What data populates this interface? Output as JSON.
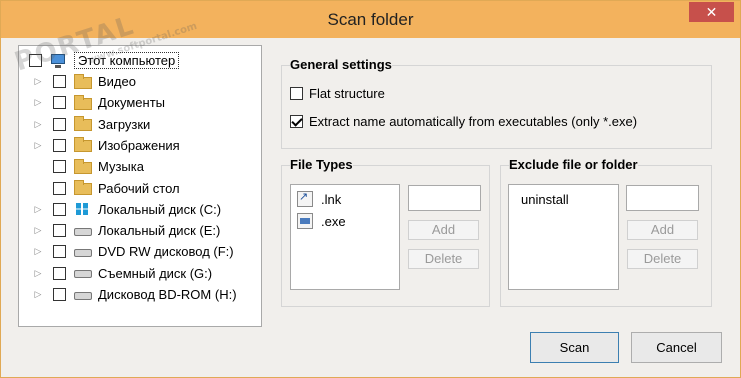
{
  "window": {
    "title": "Scan folder",
    "close_glyph": "✕"
  },
  "watermark": {
    "text": "PORTAL",
    "sub": "www.softportal.com"
  },
  "tree": {
    "root": {
      "label": "Этот компьютер",
      "icon": "computer-icon"
    },
    "items": [
      {
        "label": "Видео",
        "icon": "folder-videos-icon",
        "expandable": true
      },
      {
        "label": "Документы",
        "icon": "folder-documents-icon",
        "expandable": true
      },
      {
        "label": "Загрузки",
        "icon": "folder-downloads-icon",
        "expandable": true
      },
      {
        "label": "Изображения",
        "icon": "folder-pictures-icon",
        "expandable": true
      },
      {
        "label": "Музыка",
        "icon": "folder-music-icon",
        "expandable": false
      },
      {
        "label": "Рабочий стол",
        "icon": "folder-desktop-icon",
        "expandable": false
      },
      {
        "label": "Локальный диск (C:)",
        "icon": "windows-drive-icon",
        "expandable": true
      },
      {
        "label": "Локальный диск (E:)",
        "icon": "drive-icon",
        "expandable": true
      },
      {
        "label": "DVD RW дисковод (F:)",
        "icon": "dvd-drive-icon",
        "expandable": true
      },
      {
        "label": "Съемный диск (G:)",
        "icon": "removable-drive-icon",
        "expandable": true
      },
      {
        "label": "Дисковод BD-ROM (H:)",
        "icon": "bd-drive-icon",
        "expandable": true
      }
    ]
  },
  "general": {
    "title": "General settings",
    "flat_structure": {
      "label": "Flat structure",
      "checked": false
    },
    "extract_name": {
      "label": "Extract name automatically from executables (only *.exe)",
      "checked": true
    }
  },
  "file_types": {
    "title": "File Types",
    "items": [
      {
        "label": ".lnk",
        "icon": "shortcut-file-icon"
      },
      {
        "label": ".exe",
        "icon": "exe-file-icon"
      }
    ],
    "input_value": "",
    "add_label": "Add",
    "delete_label": "Delete"
  },
  "exclude": {
    "title": "Exclude file or folder",
    "items": [
      "uninstall"
    ],
    "input_value": "",
    "add_label": "Add",
    "delete_label": "Delete"
  },
  "footer": {
    "scan_label": "Scan",
    "cancel_label": "Cancel"
  }
}
